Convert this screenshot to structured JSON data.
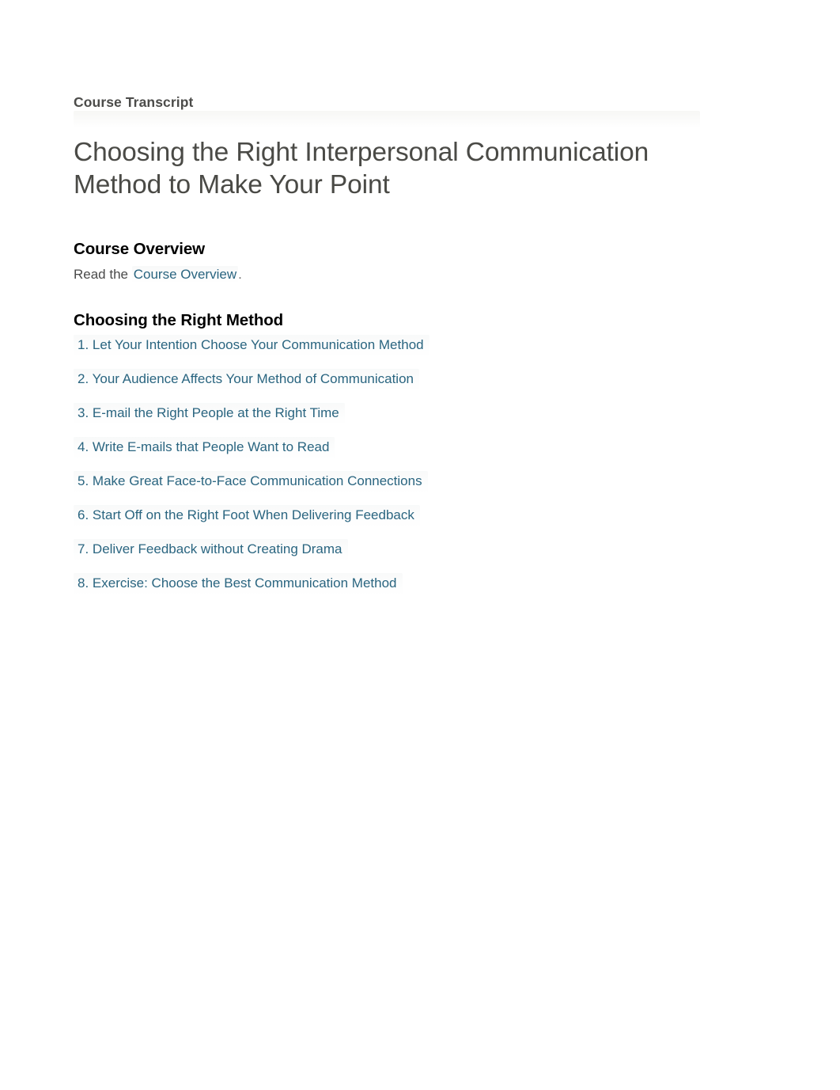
{
  "document": {
    "eyebrow": "Course Transcript",
    "title": "Choosing the Right Interpersonal Communication Method to Make Your Point",
    "background_color": "#ffffff",
    "link_color": "#2a6580",
    "heading_color": "#000000",
    "title_color": "#4a4a46"
  },
  "overview_section": {
    "heading": "Course Overview",
    "lead_text": "Read the",
    "link_label": "Course Overview",
    "trailing_text": "."
  },
  "method_section": {
    "heading": "Choosing the Right Method",
    "items": [
      {
        "number": "1.",
        "label": "Let Your Intention Choose Your Communication Method"
      },
      {
        "number": "2.",
        "label": "Your Audience Affects Your Method of Communication"
      },
      {
        "number": "3.",
        "label": "E-mail the Right People at the Right Time"
      },
      {
        "number": "4.",
        "label": "Write E-mails that People Want to Read"
      },
      {
        "number": "5.",
        "label": "Make Great Face-to-Face Communication Connections"
      },
      {
        "number": "6.",
        "label": "Start Off on the Right Foot When Delivering Feedback"
      },
      {
        "number": "7.",
        "label": "Deliver Feedback without Creating Drama"
      },
      {
        "number": "8.",
        "label": "Exercise: Choose the Best Communication Method"
      }
    ]
  }
}
